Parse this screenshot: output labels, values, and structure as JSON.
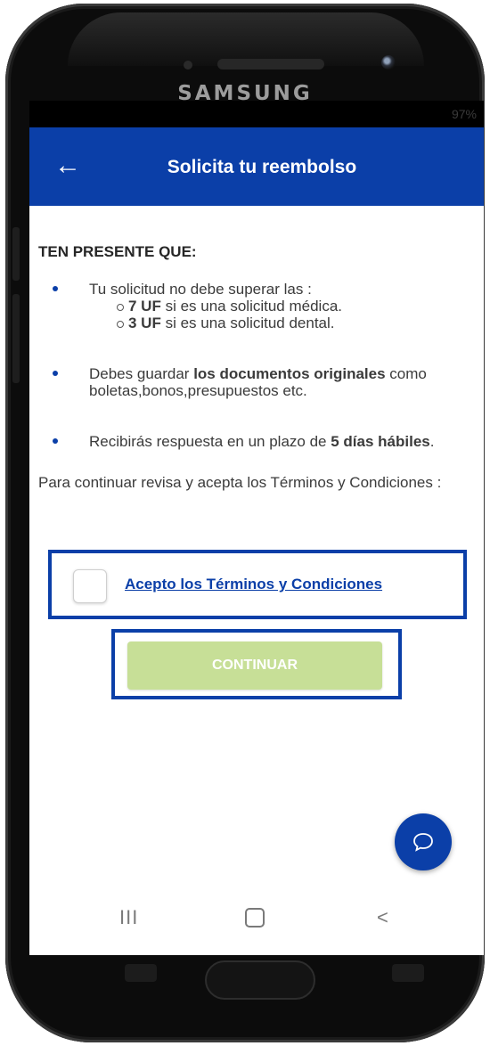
{
  "device": {
    "brand": "SAMSUNG",
    "battery": "97%"
  },
  "appbar": {
    "back_icon": "←",
    "title": "Solicita tu reembolso"
  },
  "notice": {
    "heading": "TEN PRESENTE QUE:",
    "limits_intro": "Tu solicitud no debe superar las :",
    "limits": [
      {
        "amount": "7 UF",
        "text": " si es una solicitud médica."
      },
      {
        "amount": "3 UF",
        "text": " si es una solicitud dental."
      }
    ],
    "docs_prefix": "Debes guardar ",
    "docs_bold": "los documentos originales",
    "docs_suffix": " como boletas,bonos,presupuestos etc.",
    "response_prefix": "Recibirás respuesta en un plazo de ",
    "response_bold": "5 días hábiles",
    "response_suffix": "."
  },
  "terms": {
    "intro": "Para continuar revisa y acepta los Términos y Condiciones :",
    "checkbox_checked": false,
    "link_label": "Acepto los Términos y Condiciones"
  },
  "actions": {
    "continue_label": "CONTINUAR"
  },
  "navbar": {
    "recents": "III",
    "back": "<"
  },
  "colors": {
    "primary": "#0b3fa8",
    "cta_disabled": "#c7df97"
  },
  "icons": {
    "fab": "chat-bubble-icon",
    "back": "arrow-left-icon"
  }
}
